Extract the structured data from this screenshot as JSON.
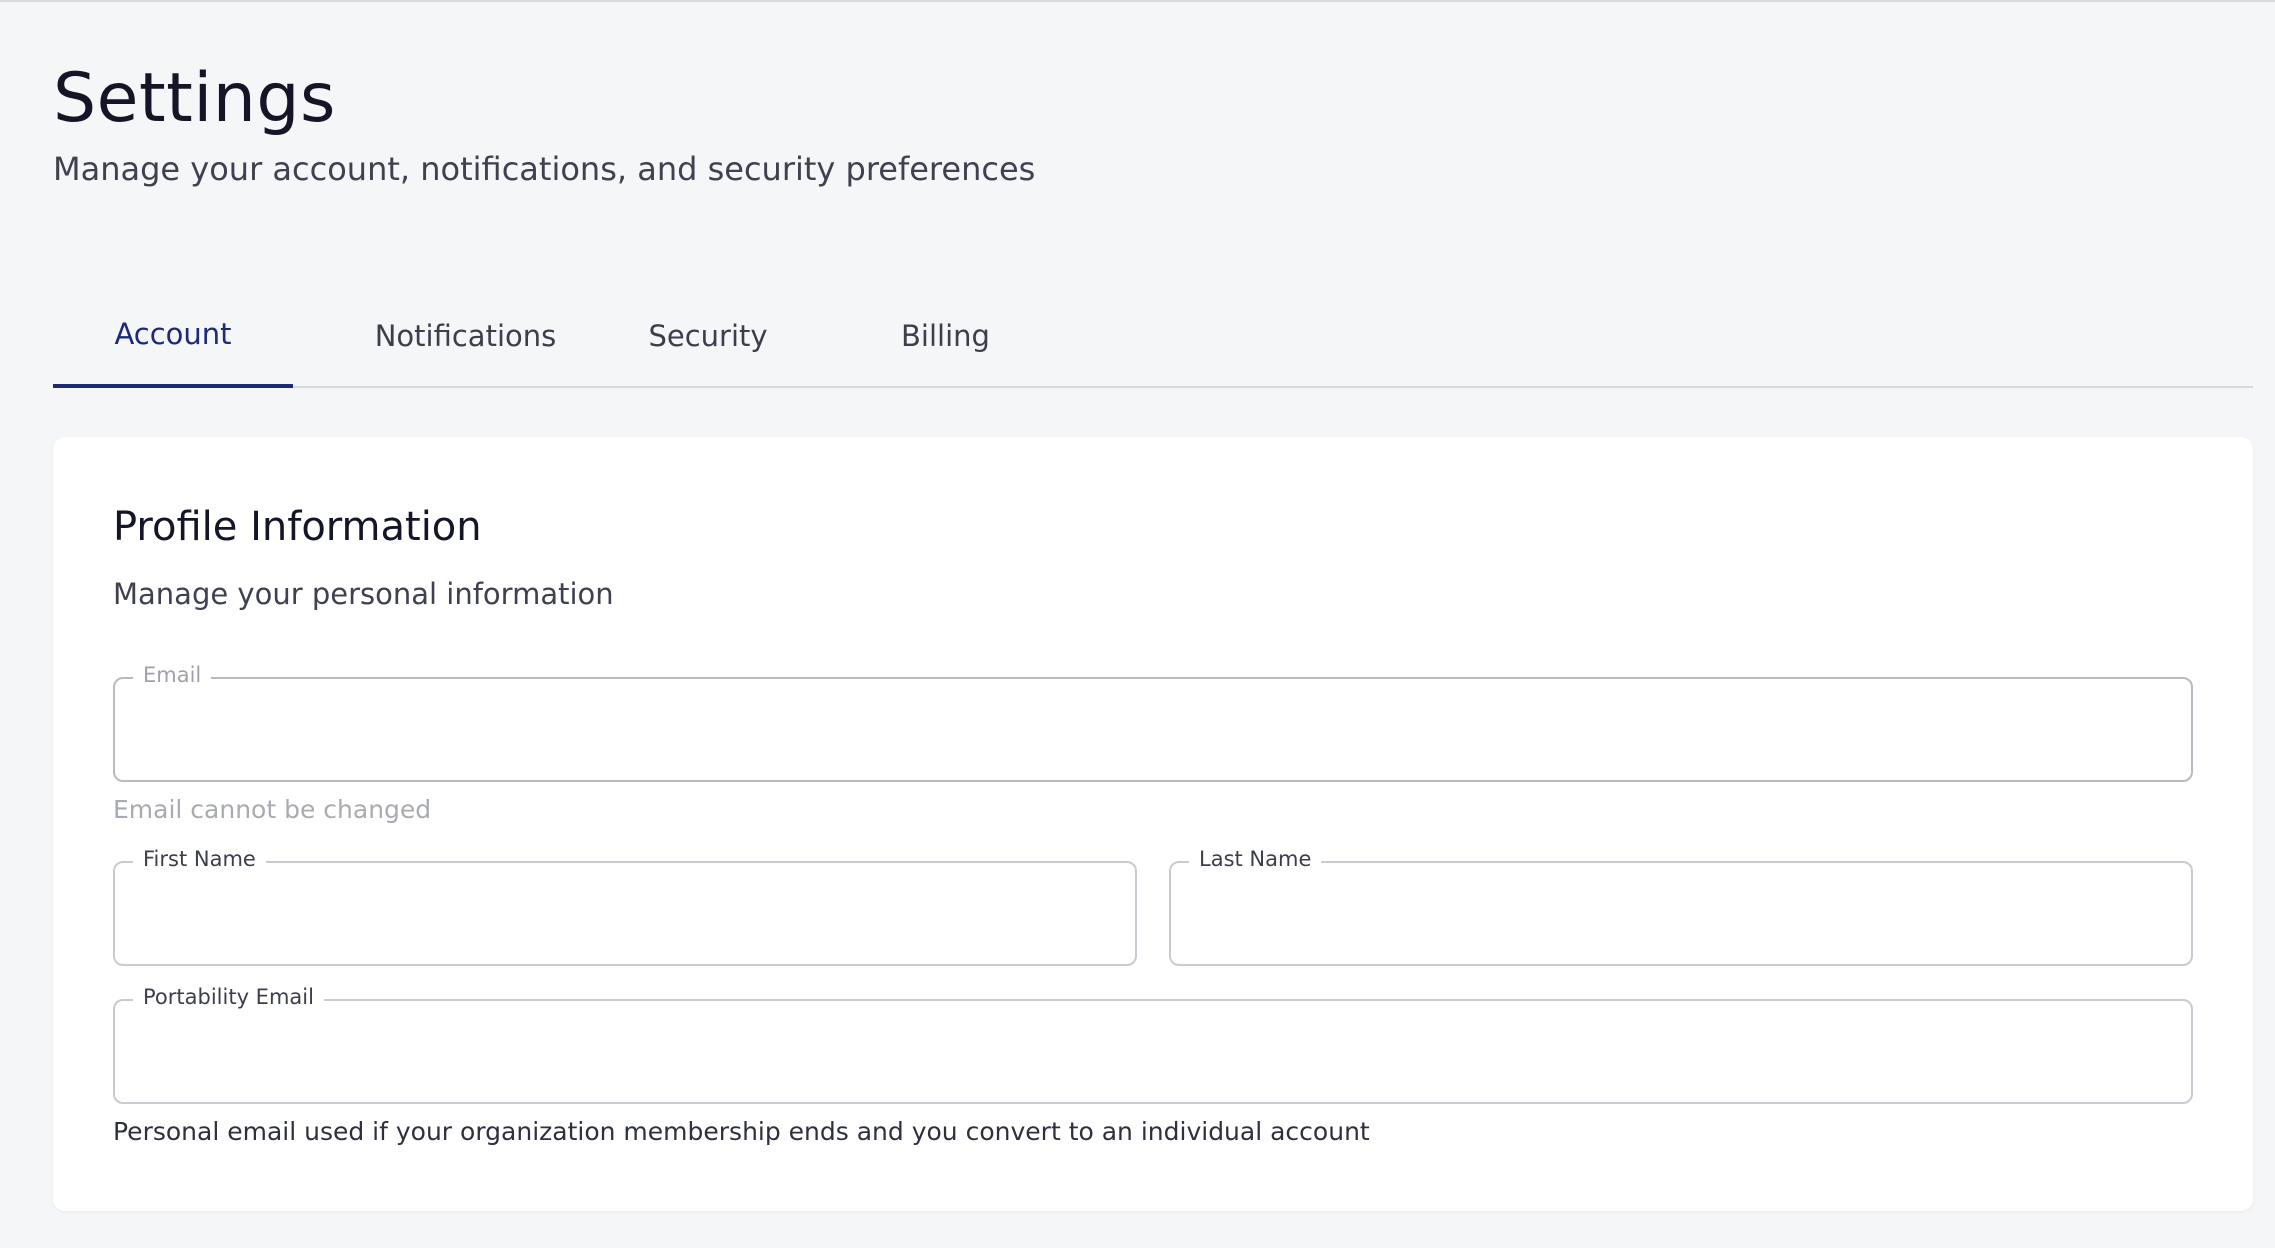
{
  "header": {
    "title": "Settings",
    "subtitle": "Manage your account, notifications, and security preferences"
  },
  "tabs": [
    {
      "label": "Account",
      "active": true
    },
    {
      "label": "Notifications",
      "active": false
    },
    {
      "label": "Security",
      "active": false
    },
    {
      "label": "Billing",
      "active": false
    }
  ],
  "profile": {
    "title": "Profile Information",
    "subtitle": "Manage your personal information",
    "email": {
      "label": "Email",
      "value": "",
      "disabled": true,
      "helper": "Email cannot be changed"
    },
    "first_name": {
      "label": "First Name",
      "value": ""
    },
    "last_name": {
      "label": "Last Name",
      "value": ""
    },
    "portability_email": {
      "label": "Portability Email",
      "value": "",
      "helper": "Personal email used if your organization membership ends and you convert to an individual account"
    }
  },
  "colors": {
    "background": "#f5f6f8",
    "accent": "#1e2a78",
    "card": "#ffffff",
    "border": "#c9cbd2"
  }
}
